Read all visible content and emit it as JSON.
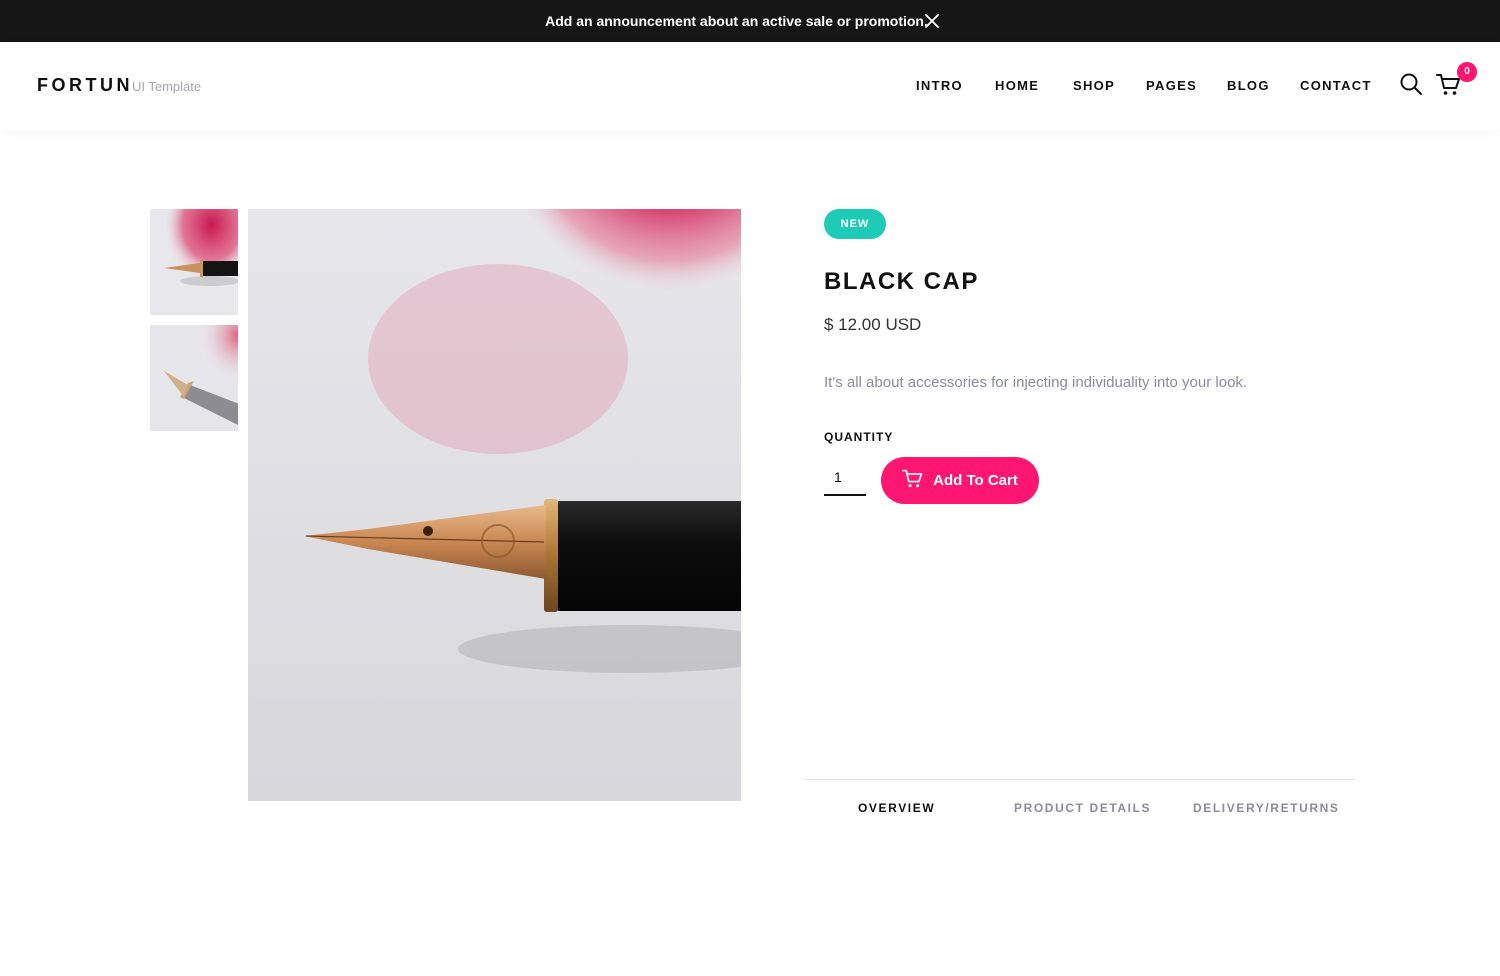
{
  "announcement": {
    "text": "Add an announcement about an active sale or promotion."
  },
  "header": {
    "brand": "FORTUN",
    "brand_sub": "UI Template",
    "nav": [
      "INTRO",
      "HOME",
      "SHOP",
      "PAGES",
      "BLOG",
      "CONTACT"
    ],
    "cart_count": "0",
    "icons": [
      "search-icon",
      "cart-icon",
      "close-icon"
    ]
  },
  "product": {
    "badge": "NEW",
    "title": "BLACK CAP",
    "price": "$ 12.00 USD",
    "description": "It's all about accessories for injecting individuality into your look.",
    "quantity_label": "QUANTITY",
    "quantity_value": "1",
    "add_to_cart_label": "Add To Cart"
  },
  "tabs": [
    "OVERVIEW",
    "PRODUCT DETAILS",
    "DELIVERY/RETURNS"
  ],
  "active_tab": "OVERVIEW",
  "colors": {
    "accent": "#ff1670",
    "badge": "#1dcbb6",
    "announcement_bg": "#161616",
    "muted_text": "#8a8aa3"
  }
}
